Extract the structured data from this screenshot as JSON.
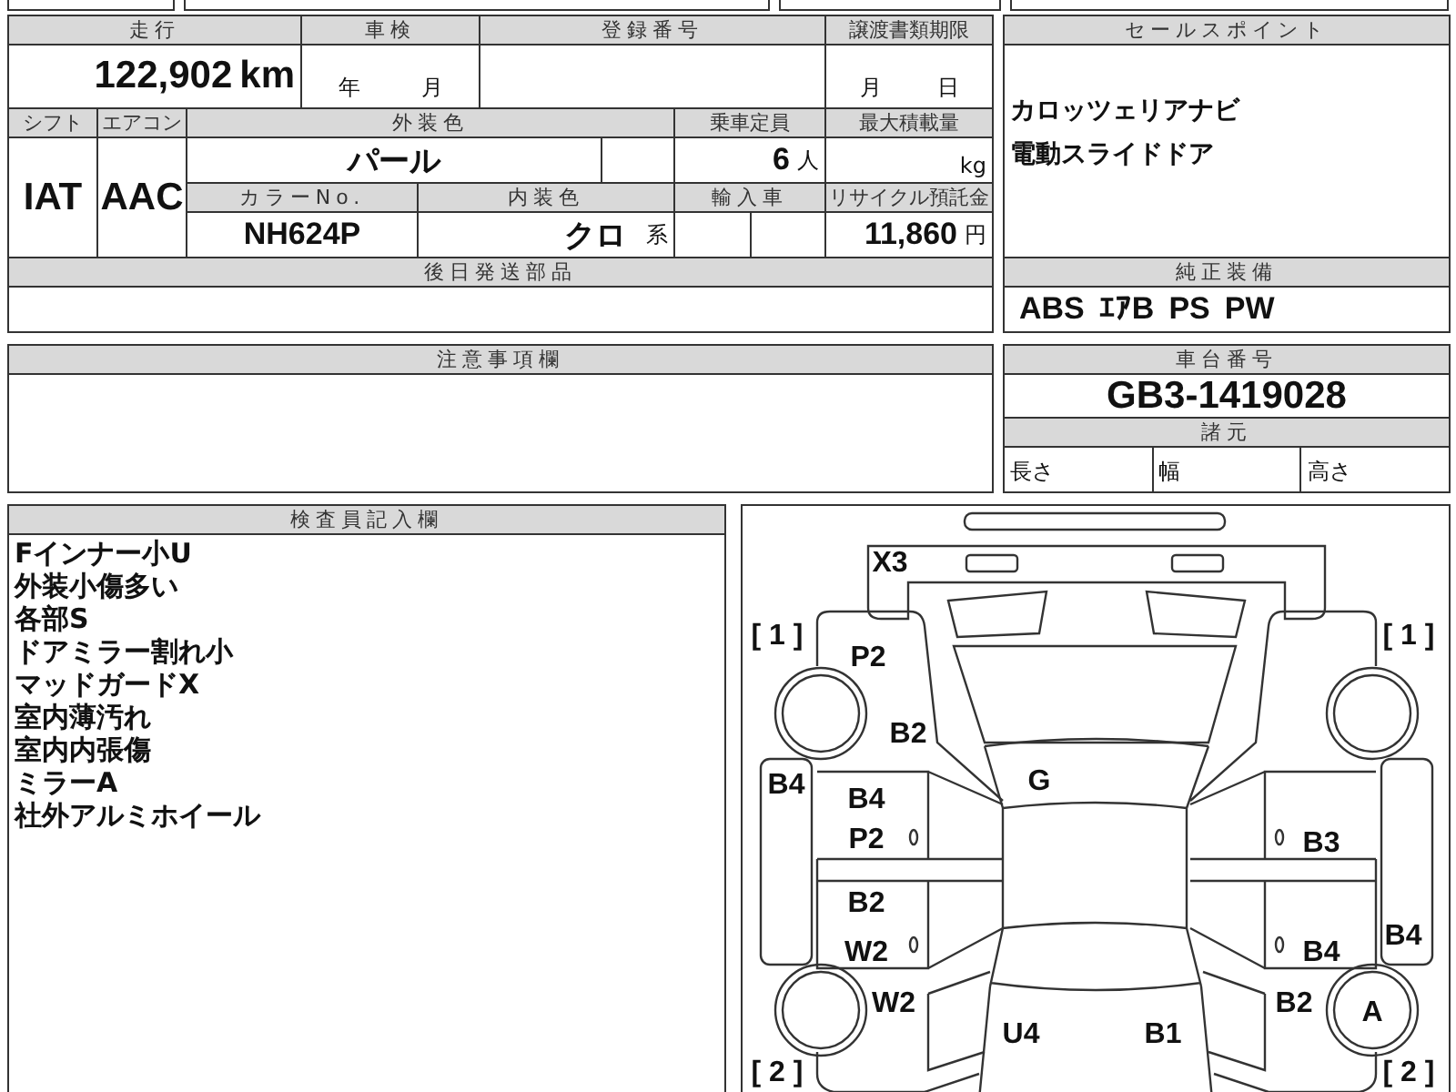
{
  "mileage": {
    "label": "走行",
    "value": "122,902",
    "unit": "km"
  },
  "inspection": {
    "label": "車検",
    "year_unit": "年",
    "month_unit": "月"
  },
  "registration_number": {
    "label": "登録番号"
  },
  "transfer_deadline": {
    "label": "譲渡書類期限",
    "month_unit": "月",
    "day_unit": "日"
  },
  "shift": {
    "label": "シフト",
    "value": "IAT"
  },
  "air_conditioner": {
    "label": "エアコン",
    "value": "AAC"
  },
  "exterior_color": {
    "label": "外装色",
    "value": "パール"
  },
  "capacity": {
    "label": "乗車定員",
    "value": "6",
    "unit": "人"
  },
  "max_load": {
    "label": "最大積載量",
    "unit": "kg"
  },
  "color_number": {
    "label": "カラーNo.",
    "value": "NH624P"
  },
  "interior_color": {
    "label": "内装色",
    "value": "クロ",
    "suffix": "系"
  },
  "imported": {
    "label": "輸入車"
  },
  "recycling_deposit": {
    "label": "リサイクル預託金",
    "value": "11,860",
    "unit": "円"
  },
  "later_shipment_parts": {
    "label": "後日発送部品"
  },
  "sales_points": {
    "label": "セールスポイント",
    "lines": [
      "カロッツェリアナビ",
      "電動スライドドア"
    ]
  },
  "standard_equipment": {
    "label": "純正装備",
    "items": [
      "ABS",
      "ｴｱB",
      "PS",
      "PW"
    ]
  },
  "notes": {
    "label": "注意事項欄"
  },
  "chassis_number": {
    "label": "車台番号",
    "value": "GB3-1419028"
  },
  "specifications": {
    "label": "諸元",
    "fields": [
      "長さ",
      "幅",
      "高さ"
    ]
  },
  "inspector_notes": {
    "label": "検査員記入欄",
    "lines": [
      "Fインナー小U",
      "外装小傷多い",
      "各部S",
      "ドアミラー割れ小",
      "マッドガードX",
      "室内薄汚れ",
      "室内内張傷",
      "ミラーA",
      "社外アルミホイール"
    ]
  },
  "damage_diagram": {
    "panel_numbers": [
      "[ 1 ]",
      "[ 1 ]",
      "[ 2 ]",
      "[ 2 ]"
    ],
    "marks": [
      "X3",
      "P2",
      "B2",
      "B4",
      "G",
      "B4",
      "P2",
      "B3",
      "B2",
      "W2",
      "B4",
      "B4",
      "W2",
      "B2",
      "A",
      "U4",
      "B1"
    ]
  }
}
